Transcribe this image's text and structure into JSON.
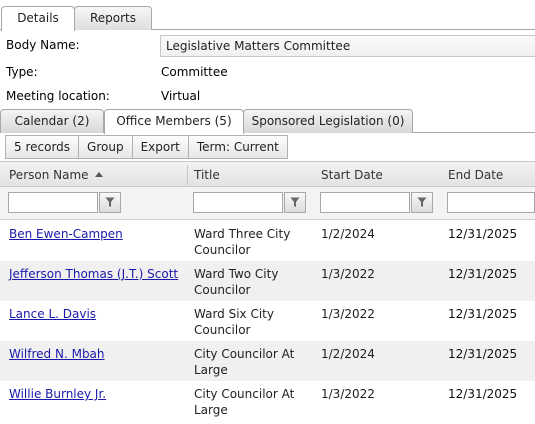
{
  "tabs": {
    "details": "Details",
    "reports": "Reports"
  },
  "body": {
    "name_label": "Body Name:",
    "name_value": "Legislative Matters Committee",
    "type_label": "Type:",
    "type_value": "Committee",
    "location_label": "Meeting location:",
    "location_value": "Virtual"
  },
  "subtabs": {
    "calendar": "Calendar (2)",
    "office_members": "Office Members (5)",
    "sponsored": "Sponsored Legislation (0)"
  },
  "toolbar": {
    "records": "5 records",
    "group": "Group",
    "export": "Export",
    "term": "Term: Current"
  },
  "grid": {
    "columns": {
      "person": "Person Name",
      "title": "Title",
      "start": "Start Date",
      "end": "End Date"
    },
    "rows": [
      {
        "name": "Ben Ewen-Campen",
        "title": "Ward Three City Councilor",
        "start": "1/2/2024",
        "end": "12/31/2025"
      },
      {
        "name": "Jefferson Thomas (J.T.) Scott",
        "title": "Ward Two City Councilor",
        "start": "1/3/2022",
        "end": "12/31/2025"
      },
      {
        "name": "Lance L. Davis",
        "title": "Ward Six City Councilor",
        "start": "1/3/2022",
        "end": "12/31/2025"
      },
      {
        "name": "Wilfred N. Mbah",
        "title": "City Councilor At Large",
        "start": "1/2/2024",
        "end": "12/31/2025"
      },
      {
        "name": "Willie Burnley Jr.",
        "title": "City Councilor At Large",
        "start": "1/3/2022",
        "end": "12/31/2025"
      }
    ]
  },
  "icons": {
    "filter": "filter-icon",
    "sort": "sort-ascending-icon"
  }
}
